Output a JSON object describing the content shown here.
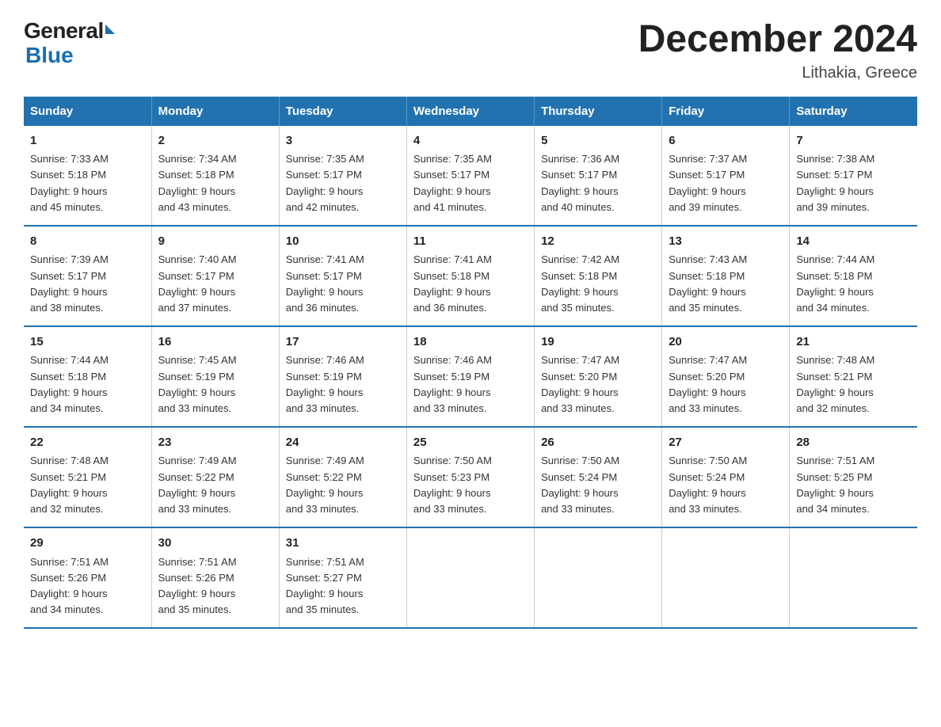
{
  "header": {
    "logo_general": "General",
    "logo_blue": "Blue",
    "title": "December 2024",
    "subtitle": "Lithakia, Greece"
  },
  "days_of_week": [
    "Sunday",
    "Monday",
    "Tuesday",
    "Wednesday",
    "Thursday",
    "Friday",
    "Saturday"
  ],
  "weeks": [
    [
      {
        "day": "1",
        "sunrise": "7:33 AM",
        "sunset": "5:18 PM",
        "daylight": "9 hours and 45 minutes."
      },
      {
        "day": "2",
        "sunrise": "7:34 AM",
        "sunset": "5:18 PM",
        "daylight": "9 hours and 43 minutes."
      },
      {
        "day": "3",
        "sunrise": "7:35 AM",
        "sunset": "5:17 PM",
        "daylight": "9 hours and 42 minutes."
      },
      {
        "day": "4",
        "sunrise": "7:35 AM",
        "sunset": "5:17 PM",
        "daylight": "9 hours and 41 minutes."
      },
      {
        "day": "5",
        "sunrise": "7:36 AM",
        "sunset": "5:17 PM",
        "daylight": "9 hours and 40 minutes."
      },
      {
        "day": "6",
        "sunrise": "7:37 AM",
        "sunset": "5:17 PM",
        "daylight": "9 hours and 39 minutes."
      },
      {
        "day": "7",
        "sunrise": "7:38 AM",
        "sunset": "5:17 PM",
        "daylight": "9 hours and 39 minutes."
      }
    ],
    [
      {
        "day": "8",
        "sunrise": "7:39 AM",
        "sunset": "5:17 PM",
        "daylight": "9 hours and 38 minutes."
      },
      {
        "day": "9",
        "sunrise": "7:40 AM",
        "sunset": "5:17 PM",
        "daylight": "9 hours and 37 minutes."
      },
      {
        "day": "10",
        "sunrise": "7:41 AM",
        "sunset": "5:17 PM",
        "daylight": "9 hours and 36 minutes."
      },
      {
        "day": "11",
        "sunrise": "7:41 AM",
        "sunset": "5:18 PM",
        "daylight": "9 hours and 36 minutes."
      },
      {
        "day": "12",
        "sunrise": "7:42 AM",
        "sunset": "5:18 PM",
        "daylight": "9 hours and 35 minutes."
      },
      {
        "day": "13",
        "sunrise": "7:43 AM",
        "sunset": "5:18 PM",
        "daylight": "9 hours and 35 minutes."
      },
      {
        "day": "14",
        "sunrise": "7:44 AM",
        "sunset": "5:18 PM",
        "daylight": "9 hours and 34 minutes."
      }
    ],
    [
      {
        "day": "15",
        "sunrise": "7:44 AM",
        "sunset": "5:18 PM",
        "daylight": "9 hours and 34 minutes."
      },
      {
        "day": "16",
        "sunrise": "7:45 AM",
        "sunset": "5:19 PM",
        "daylight": "9 hours and 33 minutes."
      },
      {
        "day": "17",
        "sunrise": "7:46 AM",
        "sunset": "5:19 PM",
        "daylight": "9 hours and 33 minutes."
      },
      {
        "day": "18",
        "sunrise": "7:46 AM",
        "sunset": "5:19 PM",
        "daylight": "9 hours and 33 minutes."
      },
      {
        "day": "19",
        "sunrise": "7:47 AM",
        "sunset": "5:20 PM",
        "daylight": "9 hours and 33 minutes."
      },
      {
        "day": "20",
        "sunrise": "7:47 AM",
        "sunset": "5:20 PM",
        "daylight": "9 hours and 33 minutes."
      },
      {
        "day": "21",
        "sunrise": "7:48 AM",
        "sunset": "5:21 PM",
        "daylight": "9 hours and 32 minutes."
      }
    ],
    [
      {
        "day": "22",
        "sunrise": "7:48 AM",
        "sunset": "5:21 PM",
        "daylight": "9 hours and 32 minutes."
      },
      {
        "day": "23",
        "sunrise": "7:49 AM",
        "sunset": "5:22 PM",
        "daylight": "9 hours and 33 minutes."
      },
      {
        "day": "24",
        "sunrise": "7:49 AM",
        "sunset": "5:22 PM",
        "daylight": "9 hours and 33 minutes."
      },
      {
        "day": "25",
        "sunrise": "7:50 AM",
        "sunset": "5:23 PM",
        "daylight": "9 hours and 33 minutes."
      },
      {
        "day": "26",
        "sunrise": "7:50 AM",
        "sunset": "5:24 PM",
        "daylight": "9 hours and 33 minutes."
      },
      {
        "day": "27",
        "sunrise": "7:50 AM",
        "sunset": "5:24 PM",
        "daylight": "9 hours and 33 minutes."
      },
      {
        "day": "28",
        "sunrise": "7:51 AM",
        "sunset": "5:25 PM",
        "daylight": "9 hours and 34 minutes."
      }
    ],
    [
      {
        "day": "29",
        "sunrise": "7:51 AM",
        "sunset": "5:26 PM",
        "daylight": "9 hours and 34 minutes."
      },
      {
        "day": "30",
        "sunrise": "7:51 AM",
        "sunset": "5:26 PM",
        "daylight": "9 hours and 35 minutes."
      },
      {
        "day": "31",
        "sunrise": "7:51 AM",
        "sunset": "5:27 PM",
        "daylight": "9 hours and 35 minutes."
      },
      null,
      null,
      null,
      null
    ]
  ],
  "labels": {
    "sunrise_prefix": "Sunrise: ",
    "sunset_prefix": "Sunset: ",
    "daylight_prefix": "Daylight: "
  }
}
